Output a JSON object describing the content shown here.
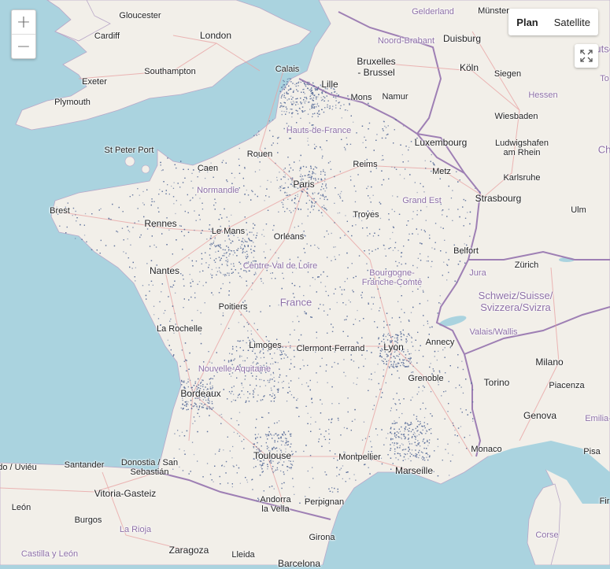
{
  "controls": {
    "zoom_in": "+",
    "zoom_out": "−",
    "layers": [
      "Plan",
      "Satellite"
    ],
    "active_layer": "Plan"
  },
  "labels": [
    {
      "id": "gloucester",
      "text": "Gloucester",
      "kind": "city"
    },
    {
      "id": "cardiff",
      "text": "Cardiff",
      "kind": "city"
    },
    {
      "id": "london",
      "text": "London",
      "kind": "city big"
    },
    {
      "id": "exeter",
      "text": "Exeter",
      "kind": "city"
    },
    {
      "id": "southampton",
      "text": "Southampton",
      "kind": "city"
    },
    {
      "id": "plymouth",
      "text": "Plymouth",
      "kind": "city"
    },
    {
      "id": "calais",
      "text": "Calais",
      "kind": "city"
    },
    {
      "id": "lille",
      "text": "Lille",
      "kind": "city big"
    },
    {
      "id": "bruxelles",
      "text": "Bruxelles\n- Brussel",
      "kind": "city big"
    },
    {
      "id": "mons",
      "text": "Mons",
      "kind": "city"
    },
    {
      "id": "namur",
      "text": "Namur",
      "kind": "city"
    },
    {
      "id": "gelderland",
      "text": "Gelderland",
      "kind": "region"
    },
    {
      "id": "noord_brabant",
      "text": "Noord-Brabant",
      "kind": "region"
    },
    {
      "id": "munster",
      "text": "Münster",
      "kind": "city"
    },
    {
      "id": "duisburg",
      "text": "Duisburg",
      "kind": "city big"
    },
    {
      "id": "koln",
      "text": "Köln",
      "kind": "city big"
    },
    {
      "id": "siegen",
      "text": "Siegen",
      "kind": "city"
    },
    {
      "id": "hessen",
      "text": "Hessen",
      "kind": "region"
    },
    {
      "id": "wiesbaden",
      "text": "Wiesbaden",
      "kind": "city"
    },
    {
      "id": "luxembourg",
      "text": "Luxembourg",
      "kind": "city big"
    },
    {
      "id": "ludwigshafen",
      "text": "Ludwigshafen\nam Rhein",
      "kind": "city"
    },
    {
      "id": "karlsruhe",
      "text": "Karlsruhe",
      "kind": "city"
    },
    {
      "id": "stpeterport",
      "text": "St Peter Port",
      "kind": "city"
    },
    {
      "id": "hauts",
      "text": "Hauts-de-France",
      "kind": "region"
    },
    {
      "id": "rouen",
      "text": "Rouen",
      "kind": "city"
    },
    {
      "id": "caen",
      "text": "Caen",
      "kind": "city"
    },
    {
      "id": "normandie",
      "text": "Normandie",
      "kind": "region"
    },
    {
      "id": "reims",
      "text": "Reims",
      "kind": "city"
    },
    {
      "id": "metz",
      "text": "Metz",
      "kind": "city"
    },
    {
      "id": "paris",
      "text": "Paris",
      "kind": "city big"
    },
    {
      "id": "grandest",
      "text": "Grand Est",
      "kind": "region"
    },
    {
      "id": "strasbourg",
      "text": "Strasbourg",
      "kind": "city big"
    },
    {
      "id": "brest",
      "text": "Brest",
      "kind": "city"
    },
    {
      "id": "rennes",
      "text": "Rennes",
      "kind": "city big"
    },
    {
      "id": "lemans",
      "text": "Le Mans",
      "kind": "city"
    },
    {
      "id": "troyes",
      "text": "Troyes",
      "kind": "city"
    },
    {
      "id": "ulm",
      "text": "Ulm",
      "kind": "city"
    },
    {
      "id": "orleans",
      "text": "Orléans",
      "kind": "city"
    },
    {
      "id": "belfort",
      "text": "Belfort",
      "kind": "city"
    },
    {
      "id": "centre",
      "text": "Centre-Val de Loire",
      "kind": "region"
    },
    {
      "id": "zurich",
      "text": "Zürich",
      "kind": "city"
    },
    {
      "id": "nantes",
      "text": "Nantes",
      "kind": "city big"
    },
    {
      "id": "bourgogne",
      "text": "Bourgogne-\nFranche-Comté",
      "kind": "region"
    },
    {
      "id": "jura",
      "text": "Jura",
      "kind": "region"
    },
    {
      "id": "schweiz",
      "text": "Schweiz/Suisse/\nSvizzera/Svizra",
      "kind": "country"
    },
    {
      "id": "france",
      "text": "France",
      "kind": "country"
    },
    {
      "id": "poitiers",
      "text": "Poitiers",
      "kind": "city"
    },
    {
      "id": "larochelle",
      "text": "La Rochelle",
      "kind": "city"
    },
    {
      "id": "annecy",
      "text": "Annecy",
      "kind": "city"
    },
    {
      "id": "valais",
      "text": "Valais/Wallis",
      "kind": "region"
    },
    {
      "id": "limoges",
      "text": "Limoges",
      "kind": "city"
    },
    {
      "id": "clermont",
      "text": "Clermont-Ferrand",
      "kind": "city"
    },
    {
      "id": "lyon",
      "text": "Lyon",
      "kind": "city big"
    },
    {
      "id": "milano",
      "text": "Milano",
      "kind": "city big"
    },
    {
      "id": "nouvelle",
      "text": "Nouvelle-Aquitaine",
      "kind": "region"
    },
    {
      "id": "grenoble",
      "text": "Grenoble",
      "kind": "city"
    },
    {
      "id": "torino",
      "text": "Torino",
      "kind": "city big"
    },
    {
      "id": "piacenza",
      "text": "Piacenza",
      "kind": "city"
    },
    {
      "id": "bordeaux",
      "text": "Bordeaux",
      "kind": "city big"
    },
    {
      "id": "genova",
      "text": "Genova",
      "kind": "city big"
    },
    {
      "id": "emilia",
      "text": "Emilia-",
      "kind": "region"
    },
    {
      "id": "toulouse",
      "text": "Toulouse",
      "kind": "city big"
    },
    {
      "id": "montpellier",
      "text": "Montpellier",
      "kind": "city"
    },
    {
      "id": "monaco",
      "text": "Monaco",
      "kind": "city"
    },
    {
      "id": "marseille",
      "text": "Marseille",
      "kind": "city big"
    },
    {
      "id": "pisa",
      "text": "Pisa",
      "kind": "city"
    },
    {
      "id": "bilbao",
      "text": "do / Uviéu",
      "kind": "city"
    },
    {
      "id": "santander",
      "text": "Santander",
      "kind": "city"
    },
    {
      "id": "donostia",
      "text": "Donostia / San\nSebastián",
      "kind": "city"
    },
    {
      "id": "vitoria",
      "text": "Vitoria-Gasteiz",
      "kind": "city big"
    },
    {
      "id": "andorra",
      "text": "Andorra\nla Vella",
      "kind": "city"
    },
    {
      "id": "perpignan",
      "text": "Perpignan",
      "kind": "city"
    },
    {
      "id": "leon",
      "text": "León",
      "kind": "city"
    },
    {
      "id": "burgos",
      "text": "Burgos",
      "kind": "city"
    },
    {
      "id": "larioja",
      "text": "La Rioja",
      "kind": "region"
    },
    {
      "id": "firenze",
      "text": "Fir",
      "kind": "city"
    },
    {
      "id": "zaragoza",
      "text": "Zaragoza",
      "kind": "city big"
    },
    {
      "id": "lleida",
      "text": "Lleida",
      "kind": "city"
    },
    {
      "id": "girona",
      "text": "Girona",
      "kind": "city"
    },
    {
      "id": "castilla",
      "text": "Castilla y León",
      "kind": "region"
    },
    {
      "id": "corse",
      "text": "Corse",
      "kind": "region"
    },
    {
      "id": "barcelona",
      "text": "Barcelona",
      "kind": "city big"
    },
    {
      "id": "deutsch",
      "text": "Deutsc",
      "kind": "country"
    },
    {
      "id": "ch",
      "text": "Ch",
      "kind": "country"
    },
    {
      "id": "to",
      "text": "To",
      "kind": "region"
    }
  ]
}
